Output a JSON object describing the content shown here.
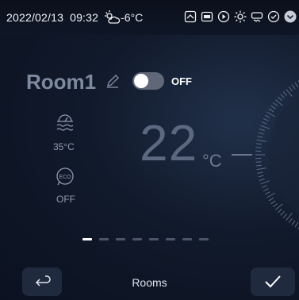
{
  "status_bar": {
    "date": "2022/02/13",
    "time": "09:32",
    "outdoor_temp": "-6°C",
    "icons": [
      "weather-icon",
      "screen-icon",
      "rri-icon",
      "play-icon",
      "sun-icon",
      "steam-icon",
      "check-circle-icon",
      "chevron-down-icon"
    ]
  },
  "room": {
    "name": "Room1",
    "power_state": "OFF",
    "power_on": false
  },
  "hot_water": {
    "icon": "hot-water-icon",
    "temperature": "35°C"
  },
  "eco": {
    "icon": "eco-icon",
    "label": "ECO",
    "state": "OFF"
  },
  "setpoint": {
    "value": "22",
    "unit": "°C"
  },
  "pager": {
    "count": 8,
    "active_index": 0
  },
  "footer": {
    "center_label": "Rooms",
    "back_icon": "return-arrow-icon",
    "confirm_icon": "check-icon"
  },
  "colors": {
    "background": "#111a2b",
    "accent_white": "#ffffff",
    "muted_text": "#8f99ac"
  }
}
